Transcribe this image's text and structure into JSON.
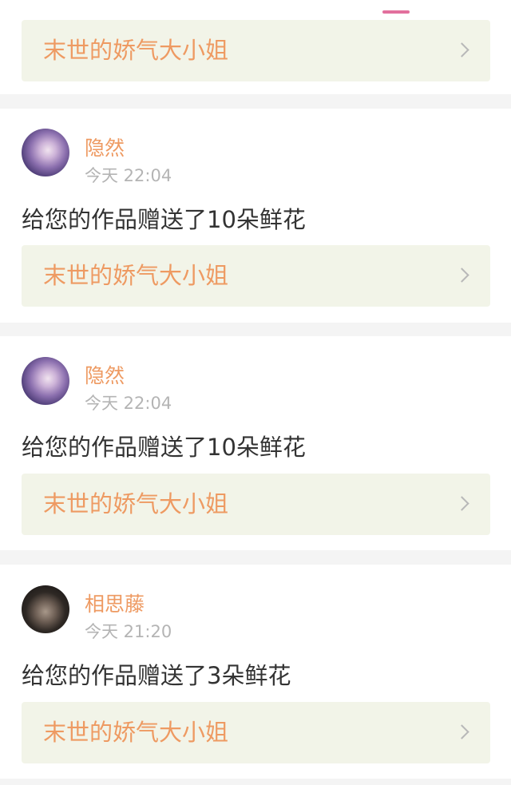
{
  "colors": {
    "accent": "#ee9a62",
    "tab_indicator": "#e2709d",
    "link_bg": "#f2f4e8",
    "time_text": "#b4b4b4",
    "message_text": "#333333",
    "separator": "#f4f4f4"
  },
  "top_card": {
    "work_title": "末世的娇气大小姐",
    "chevron_icon": "chevron-right-icon"
  },
  "notifications": [
    {
      "avatar_icon": "avatar-anime-girl",
      "username": "隐然",
      "time": "今天 22:04",
      "message": "给您的作品赠送了10朵鲜花",
      "work_title": "末世的娇气大小姐",
      "chevron_icon": "chevron-right-icon"
    },
    {
      "avatar_icon": "avatar-anime-girl",
      "username": "隐然",
      "time": "今天 22:04",
      "message": "给您的作品赠送了10朵鲜花",
      "work_title": "末世的娇气大小姐",
      "chevron_icon": "chevron-right-icon"
    },
    {
      "avatar_icon": "avatar-dark-hair",
      "username": "相思藤",
      "time": "今天 21:20",
      "message": "给您的作品赠送了3朵鲜花",
      "work_title": "末世的娇气大小姐",
      "chevron_icon": "chevron-right-icon"
    }
  ]
}
